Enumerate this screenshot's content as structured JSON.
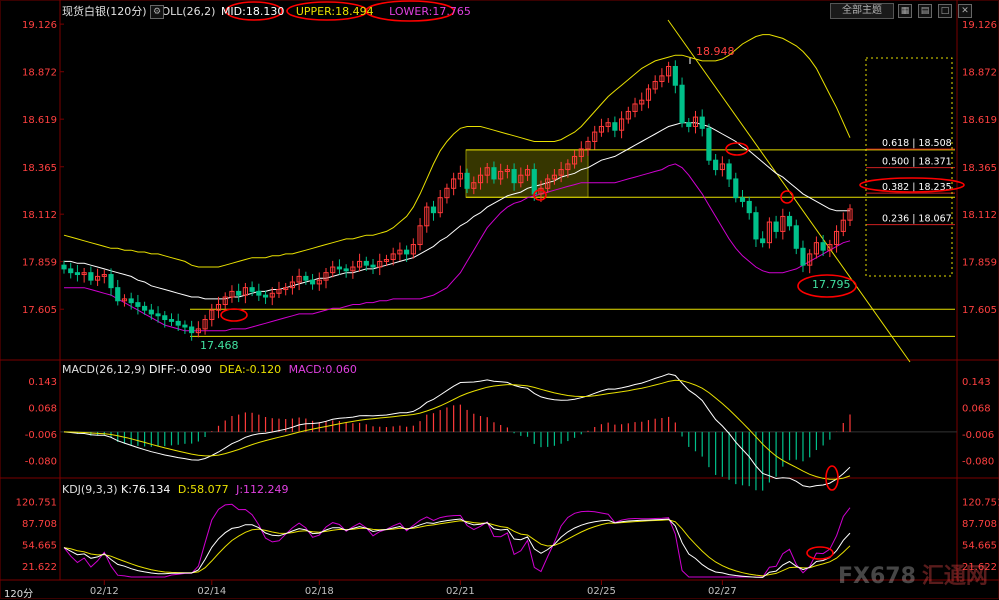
{
  "header": {
    "instrument": "现货白银",
    "period": "120分",
    "indicator_name": "BOLL(26,2)",
    "mid_label": "MID:18.130",
    "upper_label": "UPPER:18.494",
    "lower_label": "LOWER:17.765"
  },
  "toolbar": {
    "theme_button": "全部主题",
    "period_footer": "120分"
  },
  "colors": {
    "up": "#ff3a3a",
    "down": "#00c08a",
    "mid": "#ffffff",
    "upper": "#e8e000",
    "lower": "#d000d0",
    "axis_text": "#ff4040",
    "date_text": "#c0c0c0",
    "level_line": "#e8e000",
    "circle": "#ff0000"
  },
  "chart_data": [
    {
      "type": "candlestick",
      "name": "price",
      "ylim": [
        17.35,
        19.18
      ],
      "y_ticks": [
        "19.126",
        "18.872",
        "18.619",
        "18.365",
        "18.112",
        "17.859",
        "17.605"
      ],
      "x_ticks": [
        "02/12",
        "02/14",
        "02/18",
        "02/21",
        "02/25",
        "02/27"
      ],
      "annotations": {
        "high_label": "18.948",
        "low_label": "17.468",
        "recent_low_label": "17.795"
      },
      "fib_levels": [
        {
          "label": "0.618 | 18.508",
          "value": 18.47
        },
        {
          "label": "0.500 | 18.371",
          "value": 18.371
        },
        {
          "label": "0.382 | 18.235",
          "value": 18.235
        },
        {
          "label": "0.236 | 18.067",
          "value": 18.067
        }
      ],
      "horizontal_lines": [
        18.455,
        18.202,
        17.605,
        17.46
      ],
      "closes": [
        17.82,
        17.8,
        17.79,
        17.8,
        17.76,
        17.78,
        17.79,
        17.72,
        17.65,
        17.66,
        17.64,
        17.62,
        17.6,
        17.58,
        17.57,
        17.55,
        17.54,
        17.52,
        17.51,
        17.48,
        17.5,
        17.55,
        17.6,
        17.63,
        17.67,
        17.7,
        17.68,
        17.72,
        17.7,
        17.68,
        17.67,
        17.69,
        17.71,
        17.72,
        17.75,
        17.78,
        17.76,
        17.74,
        17.76,
        17.8,
        17.83,
        17.82,
        17.81,
        17.83,
        17.86,
        17.84,
        17.83,
        17.86,
        17.87,
        17.9,
        17.92,
        17.9,
        17.95,
        18.05,
        18.15,
        18.12,
        18.2,
        18.25,
        18.3,
        18.33,
        18.25,
        18.28,
        18.32,
        18.36,
        18.3,
        18.34,
        18.35,
        18.28,
        18.32,
        18.35,
        18.22,
        18.25,
        18.3,
        18.32,
        18.35,
        18.38,
        18.42,
        18.46,
        18.5,
        18.55,
        18.58,
        18.6,
        18.56,
        18.62,
        18.66,
        18.7,
        18.72,
        18.78,
        18.82,
        18.85,
        18.9,
        18.8,
        18.6,
        18.58,
        18.63,
        18.57,
        18.4,
        18.35,
        18.38,
        18.3,
        18.2,
        18.18,
        18.12,
        17.98,
        17.96,
        18.07,
        18.02,
        18.1,
        18.05,
        17.93,
        17.84,
        17.9,
        17.96,
        17.92,
        17.95,
        18.02,
        18.08,
        18.14
      ],
      "mid_band": [
        17.86,
        17.86,
        17.85,
        17.85,
        17.84,
        17.83,
        17.82,
        17.81,
        17.8,
        17.79,
        17.78,
        17.76,
        17.75,
        17.73,
        17.72,
        17.71,
        17.7,
        17.69,
        17.68,
        17.67,
        17.67,
        17.66,
        17.66,
        17.66,
        17.66,
        17.67,
        17.67,
        17.68,
        17.69,
        17.7,
        17.7,
        17.71,
        17.71,
        17.72,
        17.73,
        17.74,
        17.75,
        17.76,
        17.77,
        17.77,
        17.78,
        17.79,
        17.8,
        17.8,
        17.81,
        17.82,
        17.82,
        17.83,
        17.84,
        17.85,
        17.86,
        17.87,
        17.88,
        17.9,
        17.92,
        17.94,
        17.97,
        17.99,
        18.02,
        18.05,
        18.07,
        18.1,
        18.12,
        18.15,
        18.17,
        18.19,
        18.21,
        18.22,
        18.23,
        18.25,
        18.26,
        18.27,
        18.28,
        18.29,
        18.31,
        18.32,
        18.33,
        18.35,
        18.36,
        18.38,
        18.4,
        18.41,
        18.42,
        18.44,
        18.46,
        18.48,
        18.5,
        18.52,
        18.54,
        18.56,
        18.58,
        18.59,
        18.6,
        18.6,
        18.6,
        18.59,
        18.58,
        18.56,
        18.54,
        18.52,
        18.5,
        18.47,
        18.45,
        18.42,
        18.39,
        18.36,
        18.33,
        18.31,
        18.28,
        18.25,
        18.22,
        18.2,
        18.18,
        18.16,
        18.14,
        18.13,
        18.13,
        18.13
      ],
      "upper_band": [
        18.0,
        17.99,
        17.98,
        17.97,
        17.96,
        17.95,
        17.94,
        17.93,
        17.93,
        17.92,
        17.92,
        17.91,
        17.91,
        17.9,
        17.9,
        17.89,
        17.88,
        17.87,
        17.86,
        17.84,
        17.83,
        17.83,
        17.83,
        17.83,
        17.84,
        17.85,
        17.86,
        17.87,
        17.88,
        17.88,
        17.88,
        17.89,
        17.89,
        17.9,
        17.9,
        17.91,
        17.92,
        17.93,
        17.94,
        17.95,
        17.96,
        17.97,
        17.98,
        17.98,
        17.99,
        18.0,
        18.0,
        18.01,
        18.02,
        18.04,
        18.07,
        18.1,
        18.15,
        18.22,
        18.3,
        18.38,
        18.45,
        18.5,
        18.54,
        18.57,
        18.58,
        18.58,
        18.58,
        18.57,
        18.56,
        18.55,
        18.54,
        18.53,
        18.52,
        18.51,
        18.5,
        18.5,
        18.5,
        18.5,
        18.51,
        18.53,
        18.55,
        18.58,
        18.62,
        18.66,
        18.7,
        18.74,
        18.77,
        18.8,
        18.83,
        18.86,
        18.89,
        18.91,
        18.93,
        18.94,
        18.95,
        18.96,
        18.96,
        18.95,
        18.94,
        18.93,
        18.93,
        18.93,
        18.94,
        18.96,
        18.99,
        19.02,
        19.04,
        19.06,
        19.07,
        19.07,
        19.06,
        19.05,
        19.03,
        19.01,
        18.98,
        18.94,
        18.89,
        18.82,
        18.75,
        18.68,
        18.6,
        18.52
      ],
      "lower_band": [
        17.72,
        17.72,
        17.72,
        17.72,
        17.71,
        17.7,
        17.69,
        17.68,
        17.66,
        17.64,
        17.62,
        17.6,
        17.58,
        17.56,
        17.54,
        17.52,
        17.51,
        17.5,
        17.49,
        17.49,
        17.49,
        17.49,
        17.49,
        17.49,
        17.49,
        17.5,
        17.5,
        17.5,
        17.51,
        17.52,
        17.53,
        17.54,
        17.55,
        17.56,
        17.57,
        17.58,
        17.58,
        17.58,
        17.59,
        17.6,
        17.61,
        17.61,
        17.62,
        17.63,
        17.63,
        17.64,
        17.64,
        17.65,
        17.65,
        17.66,
        17.66,
        17.66,
        17.66,
        17.66,
        17.67,
        17.68,
        17.7,
        17.72,
        17.76,
        17.8,
        17.86,
        17.92,
        17.98,
        18.04,
        18.08,
        18.12,
        18.15,
        18.17,
        18.18,
        18.2,
        18.21,
        18.22,
        18.23,
        18.24,
        18.25,
        18.26,
        18.27,
        18.28,
        18.28,
        18.28,
        18.28,
        18.28,
        18.28,
        18.29,
        18.3,
        18.31,
        18.32,
        18.33,
        18.34,
        18.35,
        18.37,
        18.38,
        18.36,
        18.32,
        18.27,
        18.22,
        18.16,
        18.1,
        18.04,
        17.98,
        17.93,
        17.89,
        17.86,
        17.83,
        17.81,
        17.8,
        17.8,
        17.8,
        17.81,
        17.82,
        17.84,
        17.86,
        17.88,
        17.9,
        17.92,
        17.94,
        17.96,
        17.97
      ]
    },
    {
      "type": "bar+line",
      "name": "MACD(26,12,9)",
      "label": "MACD(26,12,9)",
      "diff_label": "DIFF:-0.090",
      "dea_label": "DEA:-0.120",
      "macd_label": "MACD:0.060",
      "ylim": [
        -0.115,
        0.165
      ],
      "y_ticks": [
        "0.143",
        "0.068",
        "-0.006",
        "-0.080"
      ]
    },
    {
      "type": "line",
      "name": "KDJ(9,3,3)",
      "label": "KDJ(9,3,3)",
      "k_label": "K:76.134",
      "d_label": "D:58.077",
      "j_label": "J:112.249",
      "ylim": [
        5,
        135
      ],
      "y_ticks": [
        "120.751",
        "87.708",
        "54.665",
        "21.622"
      ]
    }
  ],
  "watermark": {
    "brand": "FX678",
    "cn": "汇通网"
  }
}
